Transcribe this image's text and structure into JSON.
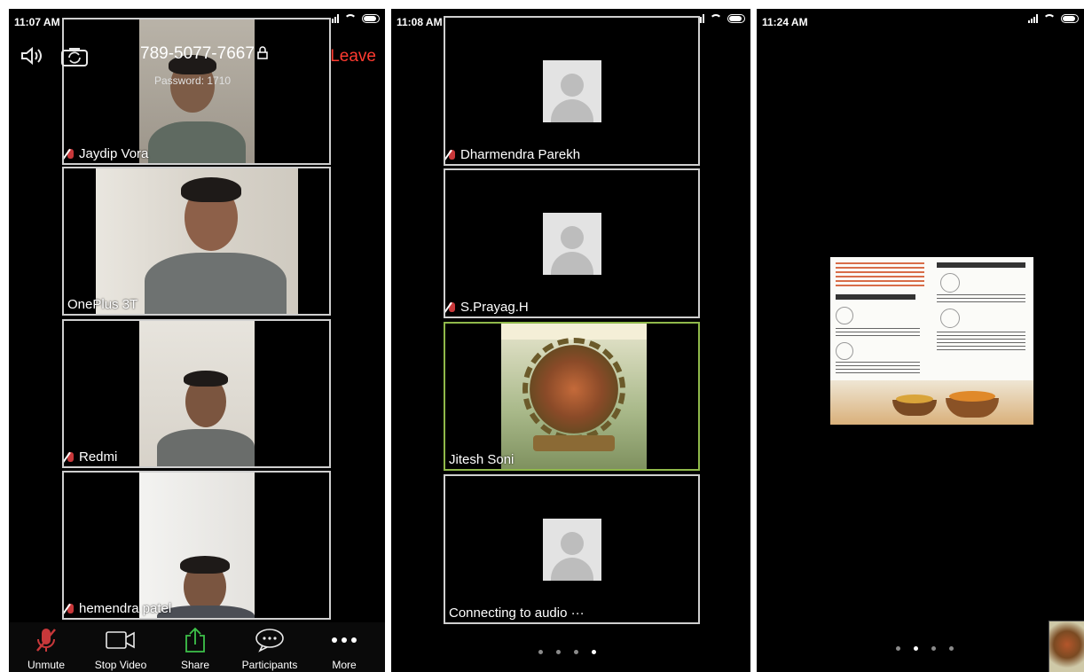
{
  "phone1": {
    "status_time": "11:07 AM",
    "meeting_id": "789-5077-7667",
    "password": "Password: 1710",
    "leave_label": "Leave",
    "tiles": [
      {
        "name": "Jaydip Vora",
        "muted": true
      },
      {
        "name": "OnePlus 3T",
        "muted": false
      },
      {
        "name": "Redmi",
        "muted": true
      },
      {
        "name": "hemendra patel",
        "muted": true
      }
    ],
    "toolbar": {
      "unmute": "Unmute",
      "stop_video": "Stop Video",
      "share": "Share",
      "participants": "Participants",
      "more": "More"
    }
  },
  "phone2": {
    "status_time": "11:08 AM",
    "tiles": [
      {
        "name": "Dharmendra Parekh",
        "muted": true
      },
      {
        "name": "S.Prayag.H",
        "muted": true
      },
      {
        "name": "Jitesh Soni",
        "muted": false,
        "active": true
      },
      {
        "name": "Connecting to audio ···",
        "muted": false
      }
    ],
    "pager": {
      "count": 4,
      "active": 3
    }
  },
  "phone3": {
    "status_time": "11:24 AM",
    "pager": {
      "count": 4,
      "active": 1
    }
  },
  "colors": {
    "leave": "#ff3b30",
    "mute_red": "#c8383a",
    "active_border": "#8fb84a",
    "share_green": "#3ec24a"
  }
}
